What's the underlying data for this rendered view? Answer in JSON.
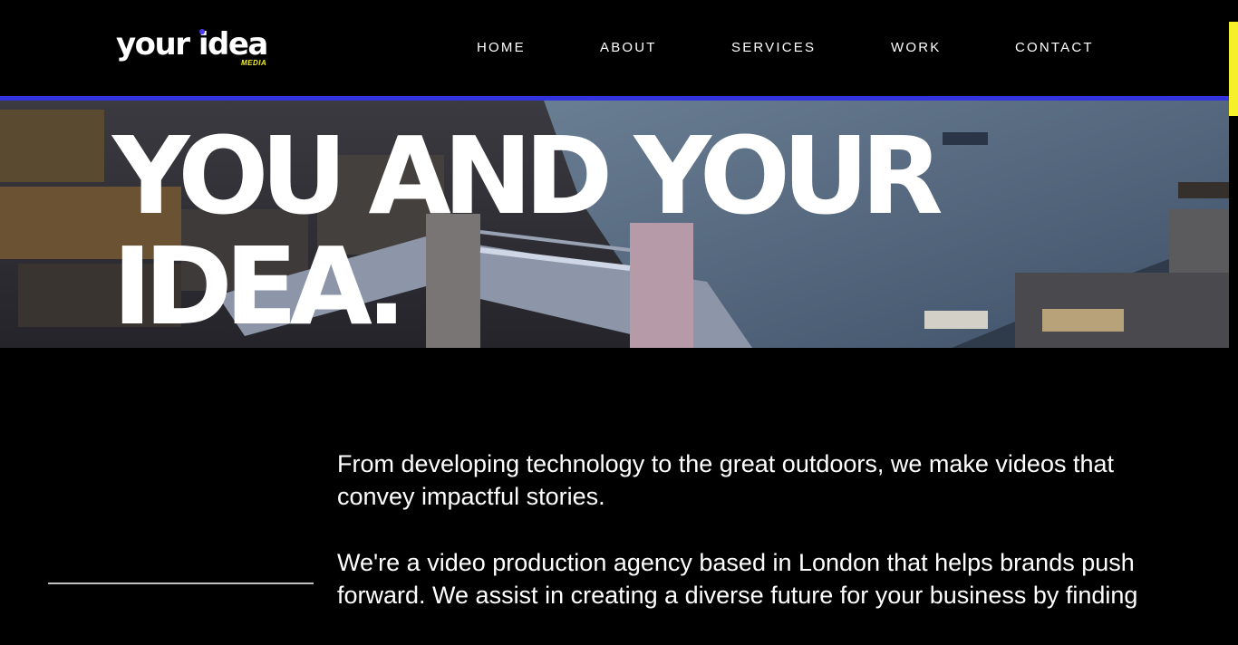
{
  "brand": {
    "logo_main": "your idea",
    "logo_sub": "MEDIA"
  },
  "nav": {
    "items": [
      "HOME",
      "ABOUT",
      "SERVICES",
      "WORK",
      "CONTACT"
    ]
  },
  "hero": {
    "title_line_1": "YOU AND YOUR",
    "title_line_2": "IDEA."
  },
  "intro": {
    "paragraph_1": "From developing technology to the great outdoors, we make videos that convey impactful stories.",
    "paragraph_2": "We're a video production agency based in London that helps brands push forward. We assist in creating a diverse future for your business by finding"
  },
  "colors": {
    "background": "#000000",
    "text": "#ffffff",
    "accent_blue": "#3333e0",
    "accent_yellow": "#f5f02a",
    "logo_dot": "#4a3cf0"
  },
  "icons": {
    "hero_image": "london-tower-bridge-aerial-photo"
  }
}
